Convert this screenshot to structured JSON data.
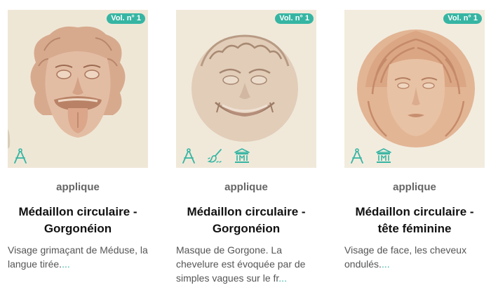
{
  "accent_color": "#36b5a3",
  "cards": [
    {
      "badge": "Vol. n° 1",
      "kind": "applique",
      "title": "Médaillon circulaire - Gorgonéion",
      "description": "Visage grimaçant de Méduse, la langue tirée.",
      "more": "...",
      "icons": [
        "compass-icon"
      ]
    },
    {
      "badge": "Vol. n° 1",
      "kind": "applique",
      "title": "Médaillon circulaire - Gorgonéion",
      "description": "Masque de Gorgone. La chevelure est évoquée par de simples vagues sur le fr",
      "more": "...",
      "icons": [
        "compass-icon",
        "restoration-brush-icon",
        "museum-icon"
      ]
    },
    {
      "badge": "Vol. n° 1",
      "kind": "applique",
      "title": "Médaillon circulaire - tête féminine",
      "description": "Visage de face, les cheveux ondulés.",
      "more": "...",
      "icons": [
        "compass-icon",
        "museum-icon"
      ]
    }
  ]
}
